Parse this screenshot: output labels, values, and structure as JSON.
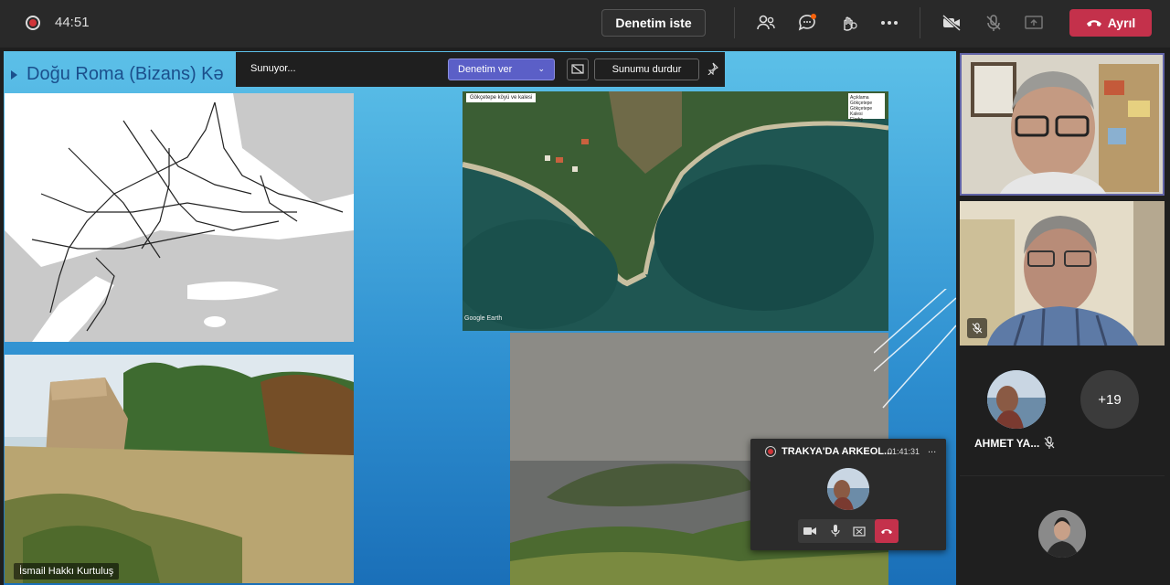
{
  "meeting": {
    "elapsed": "44:51"
  },
  "toolbar": {
    "request_control": "Denetim iste",
    "leave": "Ayrıl",
    "icons": [
      "participants-icon",
      "chat-icon",
      "reactions-icon",
      "more-icon",
      "camera-off-icon",
      "mic-off-icon",
      "share-icon"
    ]
  },
  "present_bar": {
    "status": "Sunuyor...",
    "give_control": "Denetim ver",
    "stop_presenting": "Sunumu durdur"
  },
  "slide": {
    "title": "Doğu Roma (Bizans) Kə",
    "satellite_caption": "Gökçetepe köyü ve kalesi",
    "satellite_legend": [
      "Açıklama",
      "Gökçetepe",
      "Gökçetepe Kalesi",
      "Eladıç"
    ],
    "google_earth": "Google Earth"
  },
  "presenter": {
    "name": "İsmail Hakkı Kurtuluş"
  },
  "participants": {
    "ahmet_label": "AHMET YA...",
    "more_count": "+19"
  },
  "mini_window": {
    "title": "TRAKYA'DA ARKEOL...",
    "time": "01:41:31",
    "more": "..."
  },
  "colors": {
    "leave": "#c4314b",
    "accent": "#5b5fc7",
    "slide_bg": "#2e8fd0"
  }
}
